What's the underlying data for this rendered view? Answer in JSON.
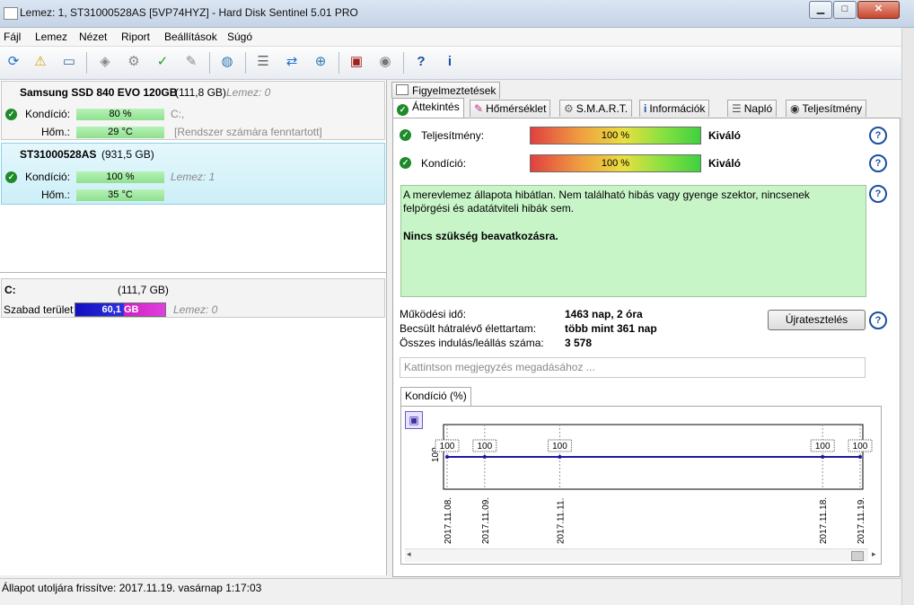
{
  "window": {
    "title": "Lemez: 1, ST31000528AS [5VP74HYZ]  -  Hard Disk Sentinel 5.01 PRO",
    "btn_min": "▁",
    "btn_max": "□",
    "btn_close": "✕"
  },
  "menu": [
    "Fájl",
    "Lemez",
    "Nézet",
    "Riport",
    "Beállítások",
    "Súgó"
  ],
  "disks": [
    {
      "name": "Samsung SSD 840 EVO 120GB",
      "size": "(111,8 GB)",
      "lemez": "Lemez: 0",
      "kondicio_label": "Kondíció:",
      "kondicio_value": "80 %",
      "kondicio_note": "C:,",
      "hom_label": "Hőm.:",
      "hom_value": "29 °C",
      "hom_note": "[Rendszer számára fenntartott]"
    },
    {
      "name": "ST31000528AS",
      "size": "(931,5 GB)",
      "lemez": "Lemez: 1",
      "kondicio_label": "Kondíció:",
      "kondicio_value": "100 %",
      "hom_label": "Hőm.:",
      "hom_value": "35 °C"
    }
  ],
  "partition": {
    "letter": "C:",
    "size": "(111,7 GB)",
    "free_label": "Szabad terület",
    "free_value": "60,1 GB",
    "lemez": "Lemez: 0",
    "fill_fraction": 0.54
  },
  "tabs_top": [
    "Figyelmeztetések"
  ],
  "tabs": [
    "Áttekintés",
    "Hőmérséklet",
    "S.M.A.R.T.",
    "Információk",
    "Napló",
    "Teljesítmény"
  ],
  "overview": {
    "perf_label": "Teljesítmény:",
    "perf_value": "100 %",
    "perf_rating": "Kiváló",
    "cond_label": "Kondíció:",
    "cond_value": "100 %",
    "cond_rating": "Kiváló",
    "status_text": "A merevlemez állapota hibátlan. Nem található hibás vagy gyenge szektor, nincsenek felpörgési és adatátviteli hibák sem.",
    "status_bold": "Nincs szükség beavatkozásra.",
    "uptime_label": "Működési idő:",
    "uptime_value": "1463 nap, 2 óra",
    "life_label": "Becsült hátralévő élettartam:",
    "life_value": "több mint 361 nap",
    "starts_label": "Összes indulás/leállás száma:",
    "starts_value": "3 578",
    "retest_label": "Újratesztelés",
    "note_placeholder": "Kattintson megjegyzés megadásához ..."
  },
  "chart_tab": "Kondíció  (%)",
  "chart_data": {
    "type": "line",
    "categories": [
      "2017.11.08.",
      "2017.11.09.",
      "2017.11.11.",
      "2017.11.18.",
      "2017.11.19."
    ],
    "values": [
      100,
      100,
      100,
      100,
      100
    ],
    "ytick": "100",
    "ylim": [
      0,
      100
    ]
  },
  "status_bar": "Állapot utoljára frissítve: 2017.11.19. vasárnap 1:17:03",
  "colors": {
    "accent": "#1a4fa0",
    "ok_green": "#1f8a2a",
    "status_bg": "#c8f5c8",
    "selected_row": "#d5f3fb"
  }
}
